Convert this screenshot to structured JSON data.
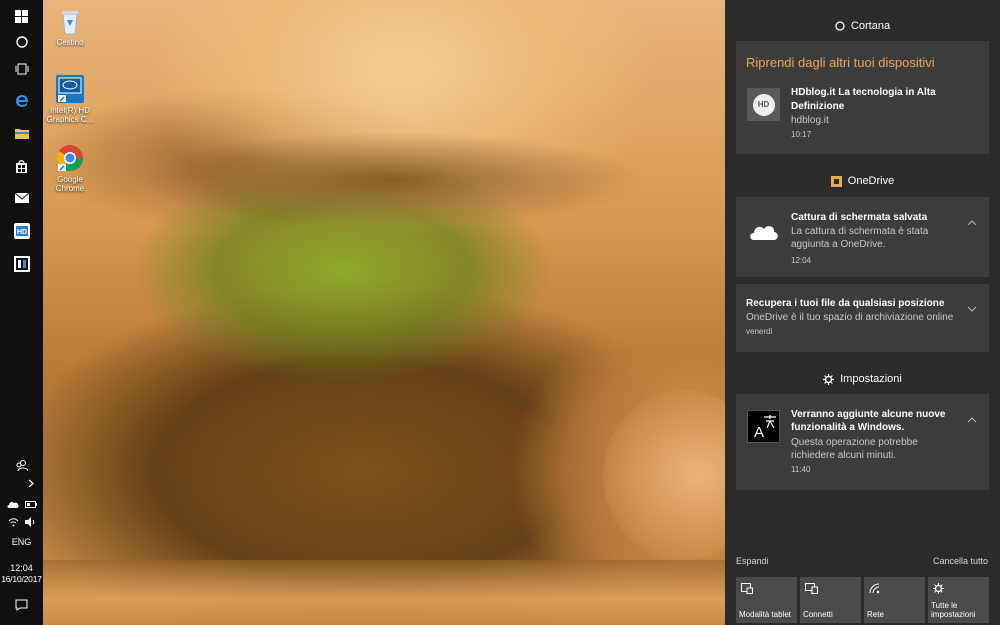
{
  "taskbar": {
    "tray": {
      "language": "ENG",
      "time": "12:04",
      "date": "16/10/2017"
    }
  },
  "desktop": {
    "icons": [
      {
        "label": "Cestino"
      },
      {
        "label": "Intel(R) HD Graphics C..."
      },
      {
        "label": "Google Chrome"
      }
    ]
  },
  "action_center": {
    "cortana": {
      "header": "Cortana",
      "card": {
        "heading": "Riprendi dagli altri tuoi dispositivi",
        "title": "HDblog.it La tecnologia in Alta Definizione",
        "source": "hdblog.it",
        "time": "10:17",
        "icon_text": "HD"
      }
    },
    "onedrive": {
      "header": "OneDrive",
      "notifications": [
        {
          "title": "Cattura di schermata salvata",
          "body": "La cattura di schermata è stata aggiunta a OneDrive.",
          "time": "12:04"
        },
        {
          "title": "Recupera i tuoi file da qualsiasi posizione",
          "body": "OneDrive è il tuo spazio di archiviazione online",
          "time": "venerdì"
        }
      ]
    },
    "settings": {
      "header": "Impostazioni",
      "notification": {
        "title": "Verranno aggiunte alcune nuove funzionalità a Windows.",
        "body": "Questa operazione potrebbe richiedere alcuni minuti.",
        "time": "11:40"
      }
    },
    "expand_label": "Espandi",
    "clear_all_label": "Cancella tutto",
    "quick_actions": [
      {
        "label": "Modalità tablet",
        "icon": "tablet-mode-icon"
      },
      {
        "label": "Connetti",
        "icon": "connect-icon"
      },
      {
        "label": "Rete",
        "icon": "network-icon"
      },
      {
        "label": "Tutte le impostazioni",
        "icon": "settings-gear-icon"
      }
    ],
    "colors": {
      "accent_heading": "#e8a85a",
      "panel": "#2b2b2b",
      "card": "#3c3c3c"
    }
  }
}
